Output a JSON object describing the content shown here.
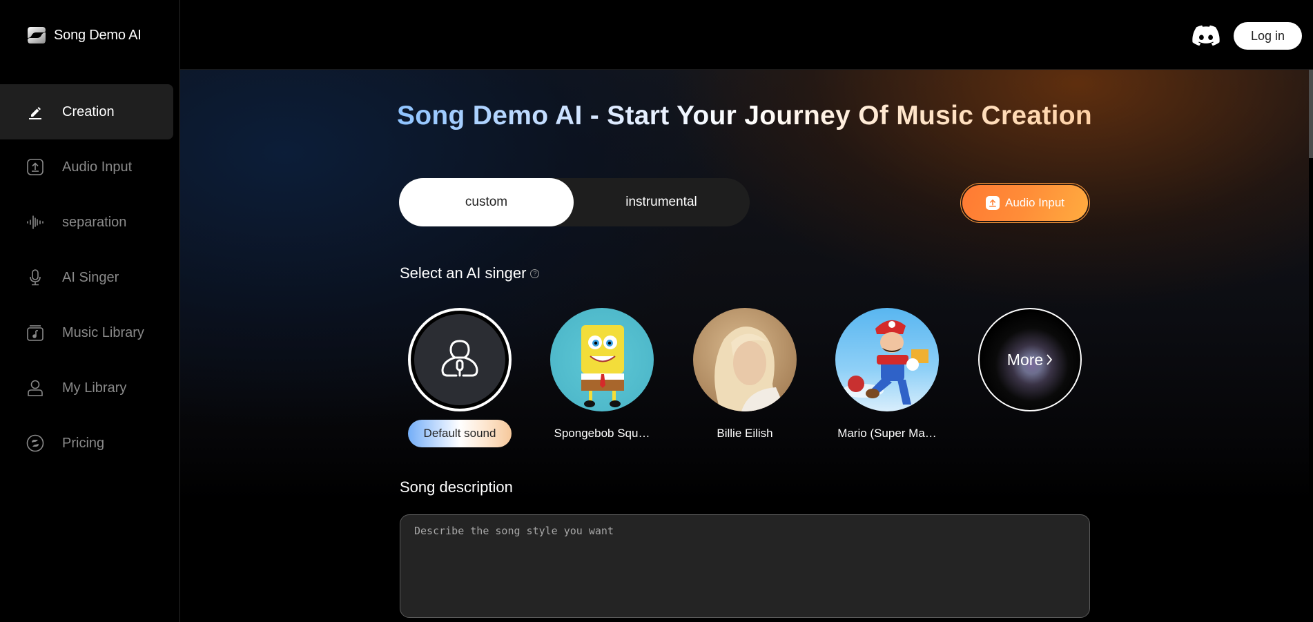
{
  "brand": {
    "name": "Song Demo AI",
    "logo_icon": "song-demo-logo"
  },
  "sidebar": {
    "items": [
      {
        "label": "Creation",
        "icon": "pencil-icon",
        "active": true
      },
      {
        "label": "Audio Input",
        "icon": "upload-icon",
        "active": false
      },
      {
        "label": "separation",
        "icon": "waveform-icon",
        "active": false
      },
      {
        "label": "AI Singer",
        "icon": "microphone-icon",
        "active": false
      },
      {
        "label": "Music Library",
        "icon": "music-folder-icon",
        "active": false
      },
      {
        "label": "My Library",
        "icon": "user-icon",
        "active": false
      },
      {
        "label": "Pricing",
        "icon": "coin-icon",
        "active": false
      }
    ]
  },
  "header": {
    "discord_icon": "discord-icon",
    "login_label": "Log in"
  },
  "main": {
    "title": "Song Demo AI - Start Your Journey Of Music Creation",
    "mode_tabs": [
      {
        "label": "custom",
        "active": true
      },
      {
        "label": "instrumental",
        "active": false
      }
    ],
    "audio_input_button": "Audio Input",
    "singer_section_label": "Select an AI singer",
    "help_glyph": "?",
    "singers": [
      {
        "name": "Default sound",
        "selected": true
      },
      {
        "name": "Spongebob Squ…",
        "selected": false
      },
      {
        "name": "Billie Eilish",
        "selected": false
      },
      {
        "name": "Mario (Super Ma…",
        "selected": false
      }
    ],
    "more_label": "More",
    "description_label": "Song description",
    "description_placeholder": "Describe the song style you want",
    "description_value": ""
  },
  "colors": {
    "accent_orange": "#ff8d38",
    "active_nav_bg": "#1f1f1f",
    "inactive_nav_text": "#8a8a8a"
  }
}
